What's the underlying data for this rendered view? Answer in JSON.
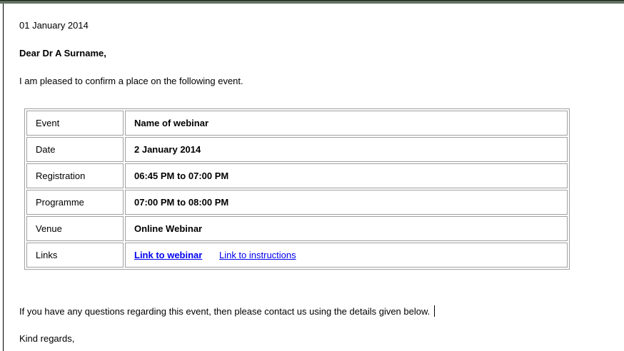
{
  "letter": {
    "date": "01 January 2014",
    "salutation": "Dear Dr A Surname,",
    "intro": "I am pleased to confirm a place on the following event.",
    "closing_paragraph": "If you have any questions regarding this event, then please contact us using the details given below.",
    "signoff": "Kind regards,"
  },
  "event_table": {
    "rows": [
      {
        "label": "Event",
        "value": "Name of webinar"
      },
      {
        "label": "Date",
        "value": "2 January 2014"
      },
      {
        "label": "Registration",
        "value": "06:45 PM to 07:00 PM"
      },
      {
        "label": "Programme",
        "value": "07:00 PM to 08:00 PM"
      },
      {
        "label": "Venue",
        "value": "Online Webinar"
      }
    ],
    "links_row": {
      "label": "Links",
      "webinar_link": "Link to webinar",
      "instructions_link": "Link to instructions"
    }
  },
  "colors": {
    "link": "#0000ee",
    "table_border": "#a0a0a0"
  }
}
